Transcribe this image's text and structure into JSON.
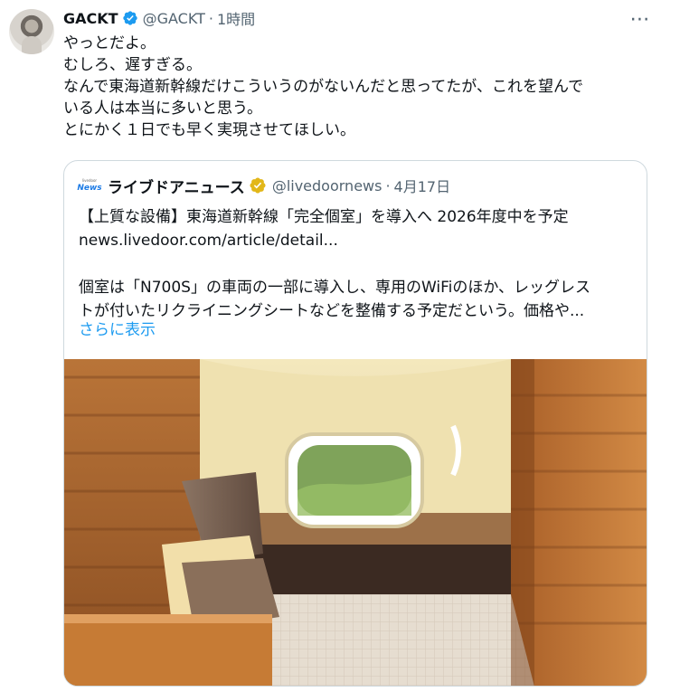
{
  "tweet": {
    "author_name": "GACKT",
    "handle": "@GACKT",
    "separator": "·",
    "time": "1時間",
    "text": "やっとだよ。\nむしろ、遅すぎる。\nなんで東海道新幹線だけこういうのがないんだと思ってたが、これを望んで\nいる人は本当に多いと思う。\nとにかく１日でも早く実現させてほしい。",
    "more_icon": "more-horizontal-icon",
    "verified_color": "#1d9bf0"
  },
  "quote": {
    "avatar_small_text": "livedoor",
    "avatar_brand_text": "News",
    "author_name": "ライブドアニュース",
    "handle": "@livedoornews",
    "separator": "·",
    "date": "4月17日",
    "text": "【上質な設備】東海道新幹線「完全個室」を導入へ 2026年度中を予定\nnews.livedoor.com/article/detail...\n\n個室は「N700S」の車両の一部に導入し、専用のWiFiのほか、レッグレス\nトが付いたリクライニングシートなどを整備する予定だという。価格や...",
    "show_more": "さらに表示",
    "verified_color": "#e2b719",
    "link_color": "#1d9bf0"
  }
}
